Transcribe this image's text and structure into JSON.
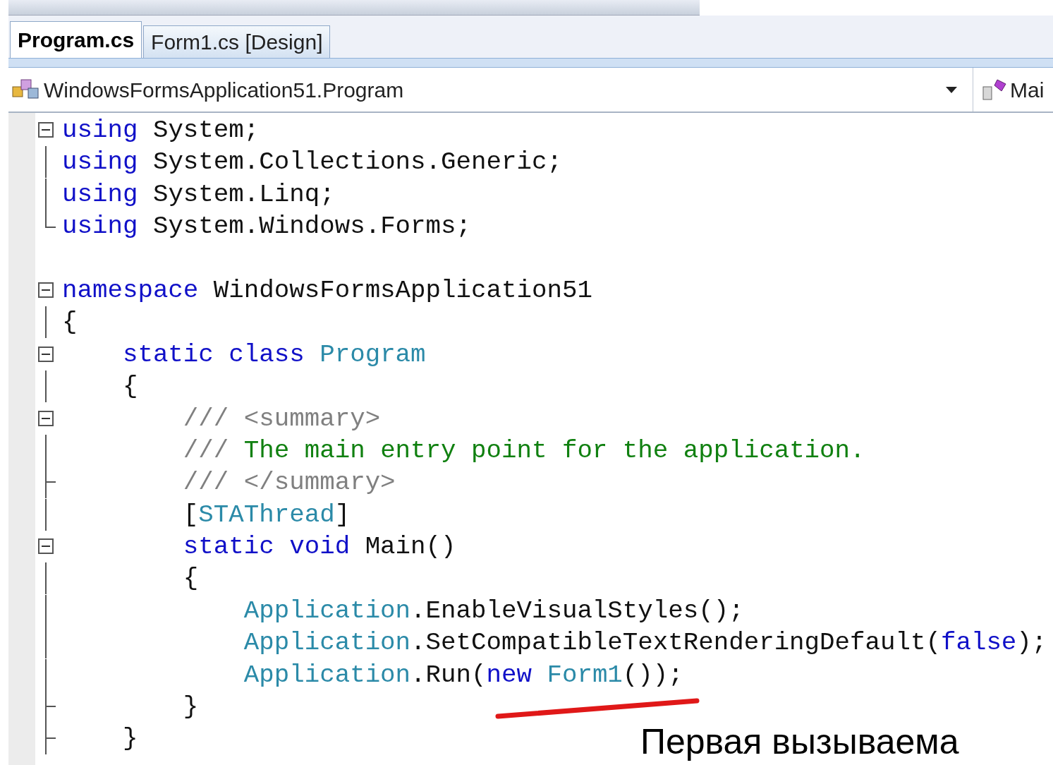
{
  "tabs": [
    {
      "label": "Program.cs",
      "selected": true
    },
    {
      "label": "Form1.cs [Design]",
      "selected": false
    }
  ],
  "navigation_bar": {
    "type_dropdown": "WindowsFormsApplication51.Program",
    "member_dropdown": "Mai"
  },
  "code_lines": [
    {
      "kind": "minus",
      "tokens": [
        {
          "kind": "keyword",
          "text": "using"
        },
        {
          "kind": "plain",
          "text": " System;"
        }
      ]
    },
    {
      "kind": "bar",
      "tokens": [
        {
          "kind": "keyword",
          "text": "using"
        },
        {
          "kind": "plain",
          "text": " System.Collections.Generic;"
        }
      ]
    },
    {
      "kind": "bar",
      "tokens": [
        {
          "kind": "keyword",
          "text": "using"
        },
        {
          "kind": "plain",
          "text": " System.Linq;"
        }
      ]
    },
    {
      "kind": "corner",
      "tokens": [
        {
          "kind": "keyword",
          "text": "using"
        },
        {
          "kind": "plain",
          "text": " System.Windows.Forms;"
        }
      ]
    },
    {
      "kind": "blank"
    },
    {
      "kind": "minus",
      "tokens": [
        {
          "kind": "keyword",
          "text": "namespace"
        },
        {
          "kind": "plain",
          "text": " WindowsFormsApplication51"
        }
      ]
    },
    {
      "kind": "bar",
      "tokens": [
        {
          "kind": "plain",
          "text": "{"
        }
      ]
    },
    {
      "kind": "minus",
      "tokens": [
        {
          "kind": "keyword",
          "text": "    static class"
        },
        {
          "kind": "type",
          "text": " Program"
        }
      ]
    },
    {
      "kind": "bar",
      "tokens": [
        {
          "kind": "plain",
          "text": "    {"
        }
      ]
    },
    {
      "kind": "minus",
      "tokens": [
        {
          "kind": "doc",
          "text": "        /// <summary>"
        }
      ]
    },
    {
      "kind": "bar",
      "tokens": [
        {
          "kind": "doc",
          "text": "        ///"
        },
        {
          "kind": "comment",
          "text": " The main entry point for the application."
        }
      ]
    },
    {
      "kind": "tick",
      "tokens": [
        {
          "kind": "doc",
          "text": "        /// </summary>"
        }
      ]
    },
    {
      "kind": "bar",
      "tokens": [
        {
          "kind": "plain",
          "text": "        ["
        },
        {
          "kind": "type",
          "text": "STAThread"
        },
        {
          "kind": "plain",
          "text": "]"
        }
      ]
    },
    {
      "kind": "minus",
      "tokens": [
        {
          "kind": "keyword",
          "text": "        static void"
        },
        {
          "kind": "plain",
          "text": " Main()"
        }
      ]
    },
    {
      "kind": "bar",
      "tokens": [
        {
          "kind": "plain",
          "text": "        {"
        }
      ]
    },
    {
      "kind": "bar",
      "tokens": [
        {
          "kind": "type",
          "text": "            Application"
        },
        {
          "kind": "plain",
          "text": ".EnableVisualStyles();"
        }
      ]
    },
    {
      "kind": "bar",
      "tokens": [
        {
          "kind": "type",
          "text": "            Application"
        },
        {
          "kind": "plain",
          "text": ".SetCompatibleTextRenderingDefault("
        },
        {
          "kind": "keyword",
          "text": "false"
        },
        {
          "kind": "plain",
          "text": ");"
        }
      ]
    },
    {
      "kind": "bar",
      "tokens": [
        {
          "kind": "type",
          "text": "            Application"
        },
        {
          "kind": "plain",
          "text": ".Run("
        },
        {
          "kind": "keyword",
          "text": "new"
        },
        {
          "kind": "type",
          "text": " Form1"
        },
        {
          "kind": "plain",
          "text": "());"
        }
      ]
    },
    {
      "kind": "tick",
      "tokens": [
        {
          "kind": "plain",
          "text": "        }"
        }
      ]
    },
    {
      "kind": "tick",
      "tokens": [
        {
          "kind": "plain",
          "text": "    }"
        }
      ]
    }
  ],
  "caption": "Первая вызываема"
}
